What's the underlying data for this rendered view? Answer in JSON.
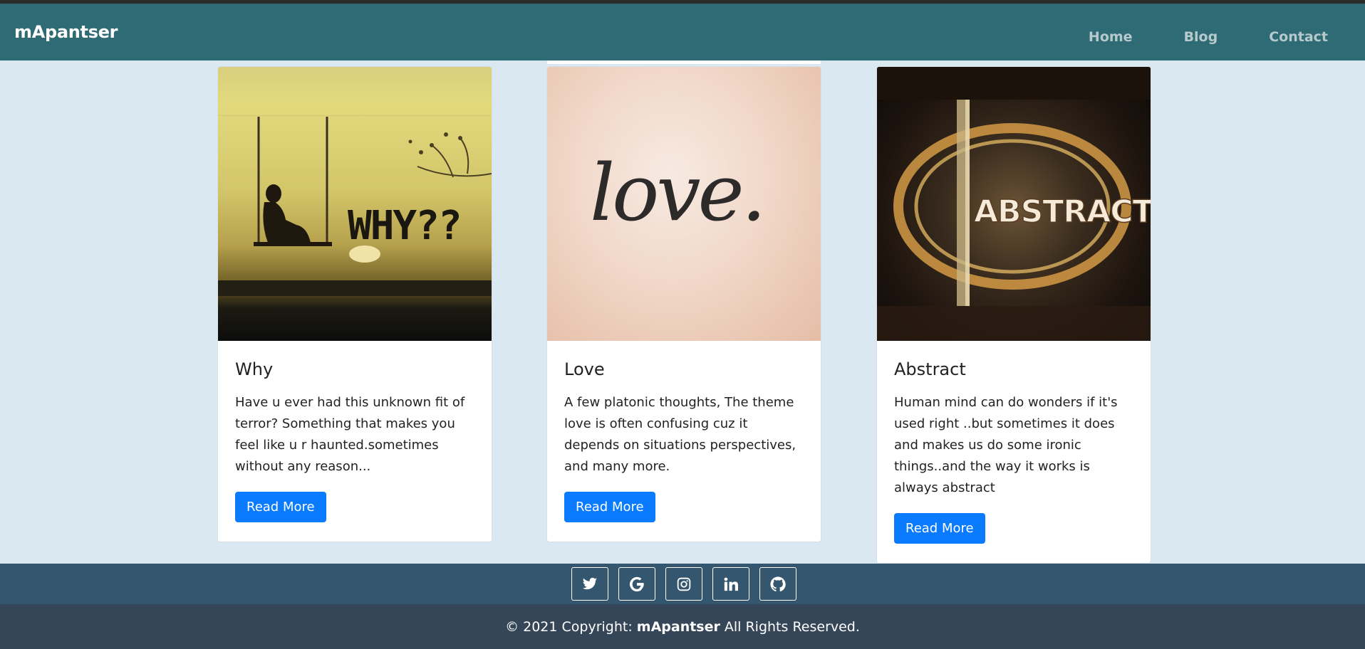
{
  "nav": {
    "brand": "mApantser",
    "links": [
      "Home",
      "Blog",
      "Contact"
    ]
  },
  "cards": [
    {
      "image_text": "WHY??",
      "title": "Why",
      "text": "Have u ever had this unknown fit of terror? Something that makes you feel like u r haunted.sometimes without any reason...",
      "button": "Read More"
    },
    {
      "image_text": "love.",
      "title": "Love",
      "text": "A few platonic thoughts, The theme love is often confusing cuz it depends on situations perspectives, and many more.",
      "button": "Read More"
    },
    {
      "image_text": "ABSTRACT",
      "title": "Abstract",
      "text": "Human mind can do wonders if it's used right ..but sometimes it does and makes us do some ironic things..and the way it works is always abstract",
      "button": "Read More"
    }
  ],
  "social": [
    "twitter-icon",
    "google-icon",
    "instagram-icon",
    "linkedin-icon",
    "github-icon"
  ],
  "footer": {
    "prefix": "© 2021 Copyright:",
    "brand": "mApantser",
    "suffix": "All Rights Reserved."
  },
  "colors": {
    "navbar": "#2e6b74",
    "page_bg": "#dae9f1",
    "button": "#0a7bff",
    "footer_social": "#34566e",
    "footer_copy": "#354658"
  }
}
